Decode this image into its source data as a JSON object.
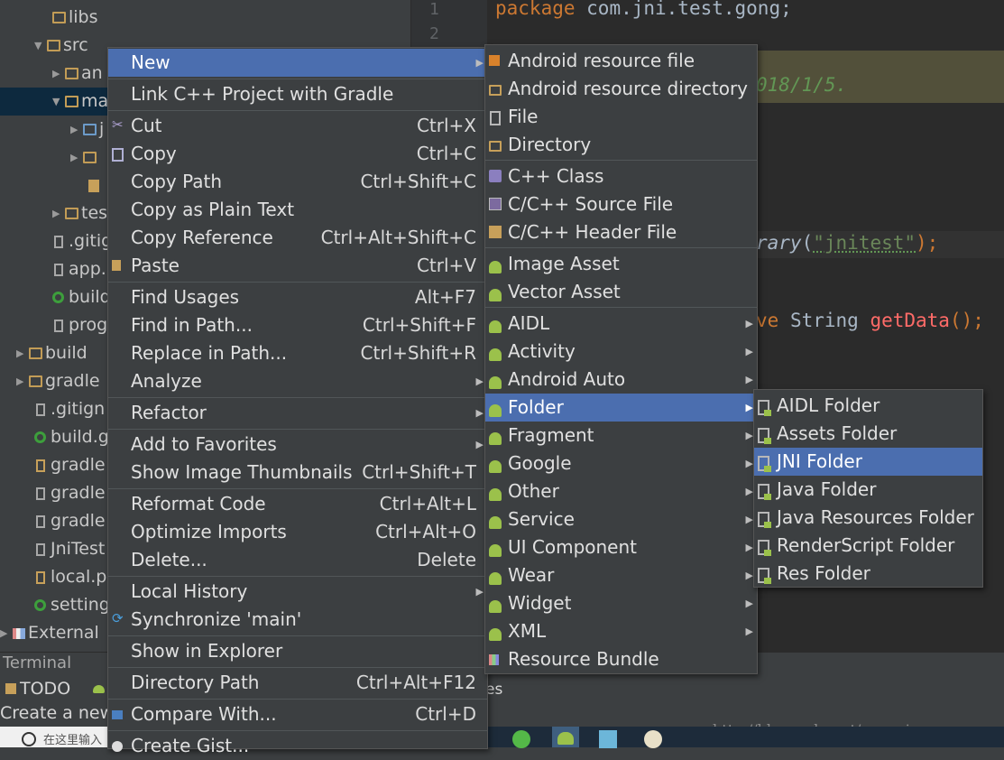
{
  "tree": {
    "items": [
      {
        "label": "libs",
        "icon": "folder-icon",
        "arrow": ""
      },
      {
        "label": "src",
        "icon": "folder-icon",
        "arrow": "▼"
      },
      {
        "label": "an",
        "icon": "folder-icon",
        "arrow": "▶"
      },
      {
        "label": "ma",
        "icon": "folder-icon",
        "arrow": "▼"
      },
      {
        "label": "j",
        "icon": "folder-icon",
        "arrow": "▶"
      },
      {
        "label": "",
        "icon": "folder-icon",
        "arrow": "▶"
      },
      {
        "label": "",
        "icon": "manifest-icon",
        "arrow": ""
      },
      {
        "label": "tes",
        "icon": "folder-icon",
        "arrow": "▶"
      },
      {
        "label": ".gitig",
        "icon": "file-icon",
        "arrow": ""
      },
      {
        "label": "app.",
        "icon": "file-icon",
        "arrow": ""
      },
      {
        "label": "build",
        "icon": "gradle-icon",
        "arrow": ""
      },
      {
        "label": "prog",
        "icon": "file-icon",
        "arrow": ""
      },
      {
        "label": "build",
        "icon": "folder-icon",
        "arrow": "▶"
      },
      {
        "label": "gradle",
        "icon": "folder-icon",
        "arrow": "▶"
      },
      {
        "label": ".gitign",
        "icon": "file-icon",
        "arrow": ""
      },
      {
        "label": "build.g",
        "icon": "gradle-icon",
        "arrow": ""
      },
      {
        "label": "gradle",
        "icon": "properties-icon",
        "arrow": ""
      },
      {
        "label": "gradle",
        "icon": "file-icon",
        "arrow": ""
      },
      {
        "label": "gradle",
        "icon": "file-icon",
        "arrow": ""
      },
      {
        "label": "JniTest",
        "icon": "iml-icon",
        "arrow": ""
      },
      {
        "label": "local.p",
        "icon": "properties-icon",
        "arrow": ""
      },
      {
        "label": "setting",
        "icon": "gradle-icon",
        "arrow": ""
      },
      {
        "label": "External",
        "icon": "library-icon",
        "arrow": "▶"
      }
    ]
  },
  "editor": {
    "line_numbers": [
      "1",
      "2"
    ],
    "line1_keyword": "package",
    "line1_text": " com.jni.test.gong;",
    "line2_comment": "018/1/5.",
    "line3_italic": "rary",
    "line3_rest": "(",
    "line3_string": "\"jnitest\"",
    "line3_end": ");",
    "line4_kw": "ve",
    "line4_type": " String ",
    "line4_method": "getData",
    "line4_end": "();"
  },
  "bottom": {
    "terminal_label": "Terminal",
    "todo_label": "TODO",
    "status_text": "Create a new",
    "search_placeholder": "在这里输入",
    "partial_es": "es",
    "watermark": "http://blog.csdn.net/gongxiaoou"
  },
  "context_menu": {
    "items": [
      {
        "label": "New",
        "shortcut": "",
        "submenu": true
      },
      {
        "label": "Link C++ Project with Gradle",
        "shortcut": ""
      },
      {
        "label": "Cut",
        "shortcut": "Ctrl+X",
        "icon": "scissors-icon"
      },
      {
        "label": "Copy",
        "shortcut": "Ctrl+C",
        "icon": "copy-icon"
      },
      {
        "label": "Copy Path",
        "shortcut": "Ctrl+Shift+C"
      },
      {
        "label": "Copy as Plain Text",
        "shortcut": ""
      },
      {
        "label": "Copy Reference",
        "shortcut": "Ctrl+Alt+Shift+C"
      },
      {
        "label": "Paste",
        "shortcut": "Ctrl+V",
        "icon": "paste-icon"
      },
      {
        "label": "Find Usages",
        "shortcut": "Alt+F7"
      },
      {
        "label": "Find in Path...",
        "shortcut": "Ctrl+Shift+F"
      },
      {
        "label": "Replace in Path...",
        "shortcut": "Ctrl+Shift+R"
      },
      {
        "label": "Analyze",
        "shortcut": "",
        "submenu": true
      },
      {
        "label": "Refactor",
        "shortcut": "",
        "submenu": true
      },
      {
        "label": "Add to Favorites",
        "shortcut": "",
        "submenu": true
      },
      {
        "label": "Show Image Thumbnails",
        "shortcut": "Ctrl+Shift+T"
      },
      {
        "label": "Reformat Code",
        "shortcut": "Ctrl+Alt+L"
      },
      {
        "label": "Optimize Imports",
        "shortcut": "Ctrl+Alt+O"
      },
      {
        "label": "Delete...",
        "shortcut": "Delete"
      },
      {
        "label": "Local History",
        "shortcut": "",
        "submenu": true
      },
      {
        "label": "Synchronize 'main'",
        "shortcut": "",
        "icon": "sync-icon"
      },
      {
        "label": "Show in Explorer",
        "shortcut": ""
      },
      {
        "label": "Directory Path",
        "shortcut": "Ctrl+Alt+F12"
      },
      {
        "label": "Compare With...",
        "shortcut": "Ctrl+D",
        "icon": "compare-icon"
      },
      {
        "label": "Create Gist...",
        "shortcut": "",
        "icon": "github-icon"
      }
    ]
  },
  "new_menu": {
    "items": [
      {
        "label": "Android resource file",
        "icon": "android-resource-icon"
      },
      {
        "label": "Android resource directory",
        "icon": "folder-icon"
      },
      {
        "label": "File",
        "icon": "file-icon"
      },
      {
        "label": "Directory",
        "icon": "folder-icon"
      },
      {
        "label": "C++ Class",
        "icon": "cpp-class-icon"
      },
      {
        "label": "C/C++ Source File",
        "icon": "cpp-source-icon"
      },
      {
        "label": "C/C++ Header File",
        "icon": "cpp-header-icon"
      },
      {
        "label": "Image Asset",
        "icon": "android-icon"
      },
      {
        "label": "Vector Asset",
        "icon": "android-icon"
      },
      {
        "label": "AIDL",
        "icon": "android-icon",
        "submenu": true
      },
      {
        "label": "Activity",
        "icon": "android-icon",
        "submenu": true
      },
      {
        "label": "Android Auto",
        "icon": "android-icon",
        "submenu": true
      },
      {
        "label": "Folder",
        "icon": "android-icon",
        "submenu": true
      },
      {
        "label": "Fragment",
        "icon": "android-icon",
        "submenu": true
      },
      {
        "label": "Google",
        "icon": "android-icon",
        "submenu": true
      },
      {
        "label": "Other",
        "icon": "android-icon",
        "submenu": true
      },
      {
        "label": "Service",
        "icon": "android-icon",
        "submenu": true
      },
      {
        "label": "UI Component",
        "icon": "android-icon",
        "submenu": true
      },
      {
        "label": "Wear",
        "icon": "android-icon",
        "submenu": true
      },
      {
        "label": "Widget",
        "icon": "android-icon",
        "submenu": true
      },
      {
        "label": "XML",
        "icon": "android-icon",
        "submenu": true
      },
      {
        "label": "Resource Bundle",
        "icon": "resource-bundle-icon"
      }
    ]
  },
  "folder_menu": {
    "items": [
      {
        "label": "AIDL Folder"
      },
      {
        "label": "Assets Folder"
      },
      {
        "label": "JNI Folder"
      },
      {
        "label": "Java Folder"
      },
      {
        "label": "Java Resources Folder"
      },
      {
        "label": "RenderScript Folder"
      },
      {
        "label": "Res Folder"
      }
    ]
  },
  "colors": {
    "highlight": "#4b6eaf",
    "keyword": "#cc7832",
    "comment": "#629755",
    "string": "#6a8759",
    "method": "#ff6b68",
    "text": "#a9b7c6"
  }
}
